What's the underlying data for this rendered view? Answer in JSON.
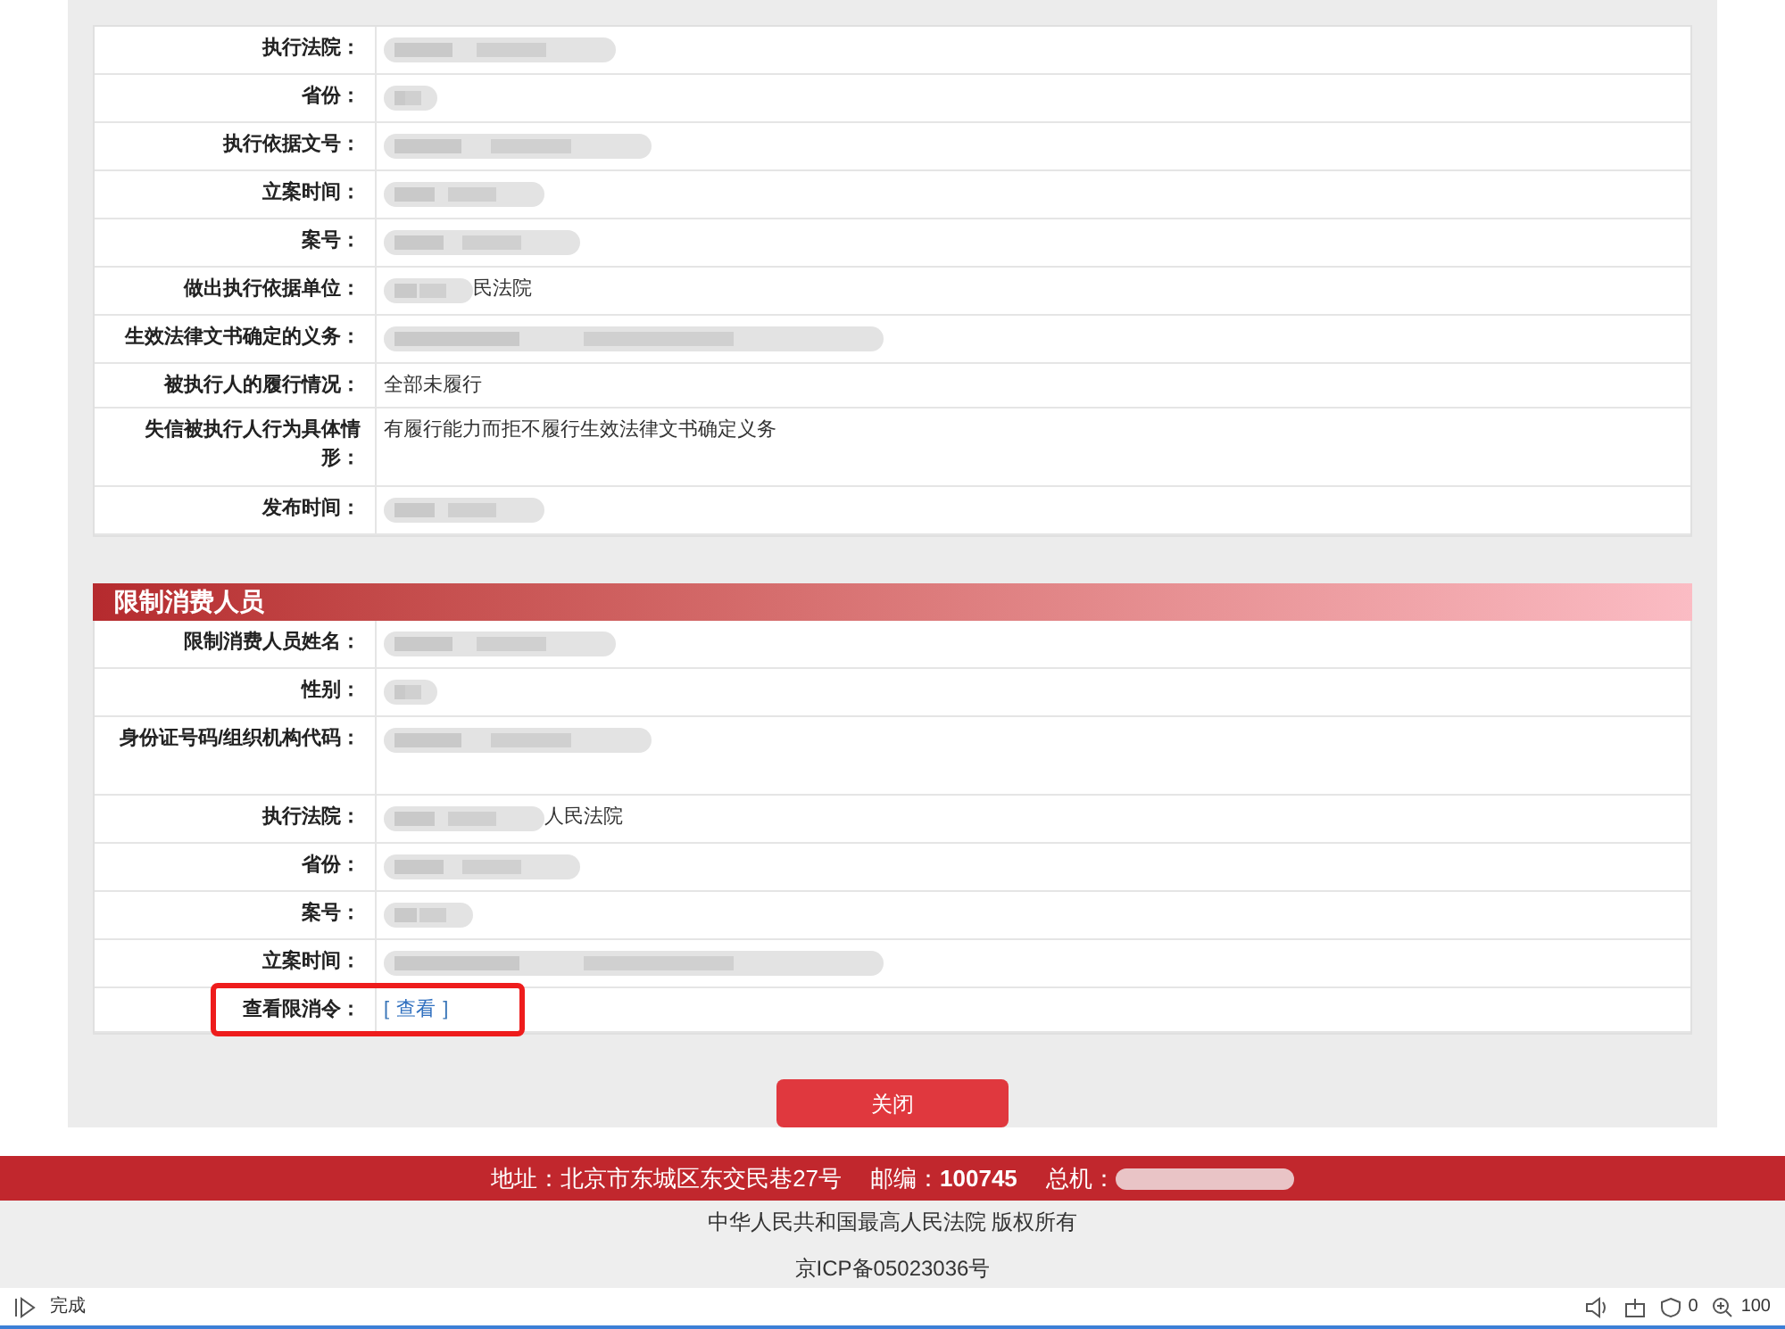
{
  "record_rows": [
    {
      "label": "执行法院：",
      "redacted": true
    },
    {
      "label": "省份：",
      "redacted": true
    },
    {
      "label": "执行依据文号：",
      "redacted": true
    },
    {
      "label": "立案时间：",
      "redacted": true
    },
    {
      "label": "案号：",
      "redacted": true
    },
    {
      "label": "做出执行依据单位：",
      "redacted": true,
      "value": "民法院"
    },
    {
      "label": "生效法律文书确定的义务：",
      "redacted": true
    },
    {
      "label": "被执行人的履行情况：",
      "redacted": false,
      "value": "全部未履行"
    },
    {
      "label": "失信被执行人行为具体情形：",
      "redacted": false,
      "value": "有履行能力而拒不履行生效法律文书确定义务"
    },
    {
      "label": "发布时间：",
      "redacted": true
    }
  ],
  "section": {
    "title": "限制消费人员",
    "rows": [
      {
        "label": "限制消费人员姓名：",
        "redacted": true,
        "highlighted": false
      },
      {
        "label": "性别：",
        "redacted": true,
        "highlighted": false
      },
      {
        "label": "身份证号码/组织机构代码：",
        "redacted": true,
        "highlighted": false
      },
      {
        "label": "执行法院：",
        "redacted": true,
        "value": "人民法院",
        "highlighted": false
      },
      {
        "label": "省份：",
        "redacted": true,
        "highlighted": false
      },
      {
        "label": "案号：",
        "redacted": true,
        "highlighted": false
      },
      {
        "label": "立案时间：",
        "redacted": true,
        "highlighted": false
      },
      {
        "label": "查看限消令：",
        "redacted": false,
        "link": {
          "open": "[",
          "text": "查看",
          "close": "]"
        },
        "highlighted": true
      }
    ]
  },
  "close_button": "关闭",
  "footer": {
    "address": "地址：北京市东城区东交民巷27号",
    "postcode_label": "邮编：",
    "postcode": "100745",
    "phone_label": "总机：",
    "phone_redacted": true,
    "copyright": "中华人民共和国最高人民法院 版权所有",
    "icp": "京ICP备05023036号"
  },
  "status_bar": {
    "status": "完成",
    "blocked_count": "0",
    "zoom": "100"
  }
}
